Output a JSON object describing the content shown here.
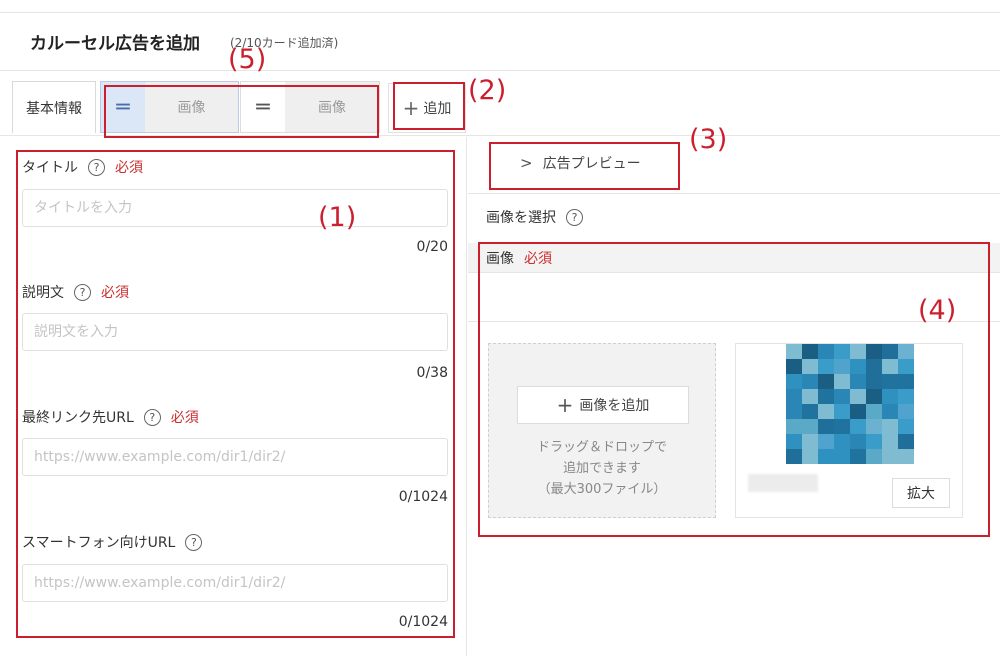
{
  "header": {
    "title": "カルーセル広告を追加",
    "subtitle": "(2/10カード追加済)"
  },
  "tabs": {
    "basic_label": "基本情報",
    "image_tabs": [
      {
        "handle": "═",
        "label": "画像"
      },
      {
        "handle": "═",
        "label": "画像"
      }
    ],
    "add_label": "追加",
    "add_icon": "plus-icon"
  },
  "form": {
    "required_label": "必須",
    "help_glyph": "?",
    "fields": [
      {
        "label": "タイトル",
        "placeholder": "タイトルを入力",
        "counter": "0/20",
        "required": true
      },
      {
        "label": "説明文",
        "placeholder": "説明文を入力",
        "counter": "0/38",
        "required": true
      },
      {
        "label": "最終リンク先URL",
        "placeholder": "https://www.example.com/dir1/dir2/",
        "counter": "0/1024",
        "required": true
      },
      {
        "label": "スマートフォン向けURL",
        "placeholder": "https://www.example.com/dir1/dir2/",
        "counter": "0/1024",
        "required": false
      }
    ]
  },
  "preview": {
    "toggle_icon": "chevron-right-icon",
    "toggle_label": "広告プレビュー"
  },
  "image_section": {
    "select_label": "画像を選択",
    "head_label": "画像",
    "required_label": "必須",
    "add_image_label": "画像を追加",
    "drop_line1": "ドラッグ＆ドロップで",
    "drop_line2": "追加できます",
    "drop_line3": "（最大300ファイル）",
    "zoom_label": "拡大"
  },
  "callouts": [
    "(1)",
    "(2)",
    "(3)",
    "(4)",
    "(5)"
  ],
  "colors": {
    "callout": "#cc1f2d",
    "required": "#cc2d2d",
    "active_handle": "#dbe7f7"
  }
}
